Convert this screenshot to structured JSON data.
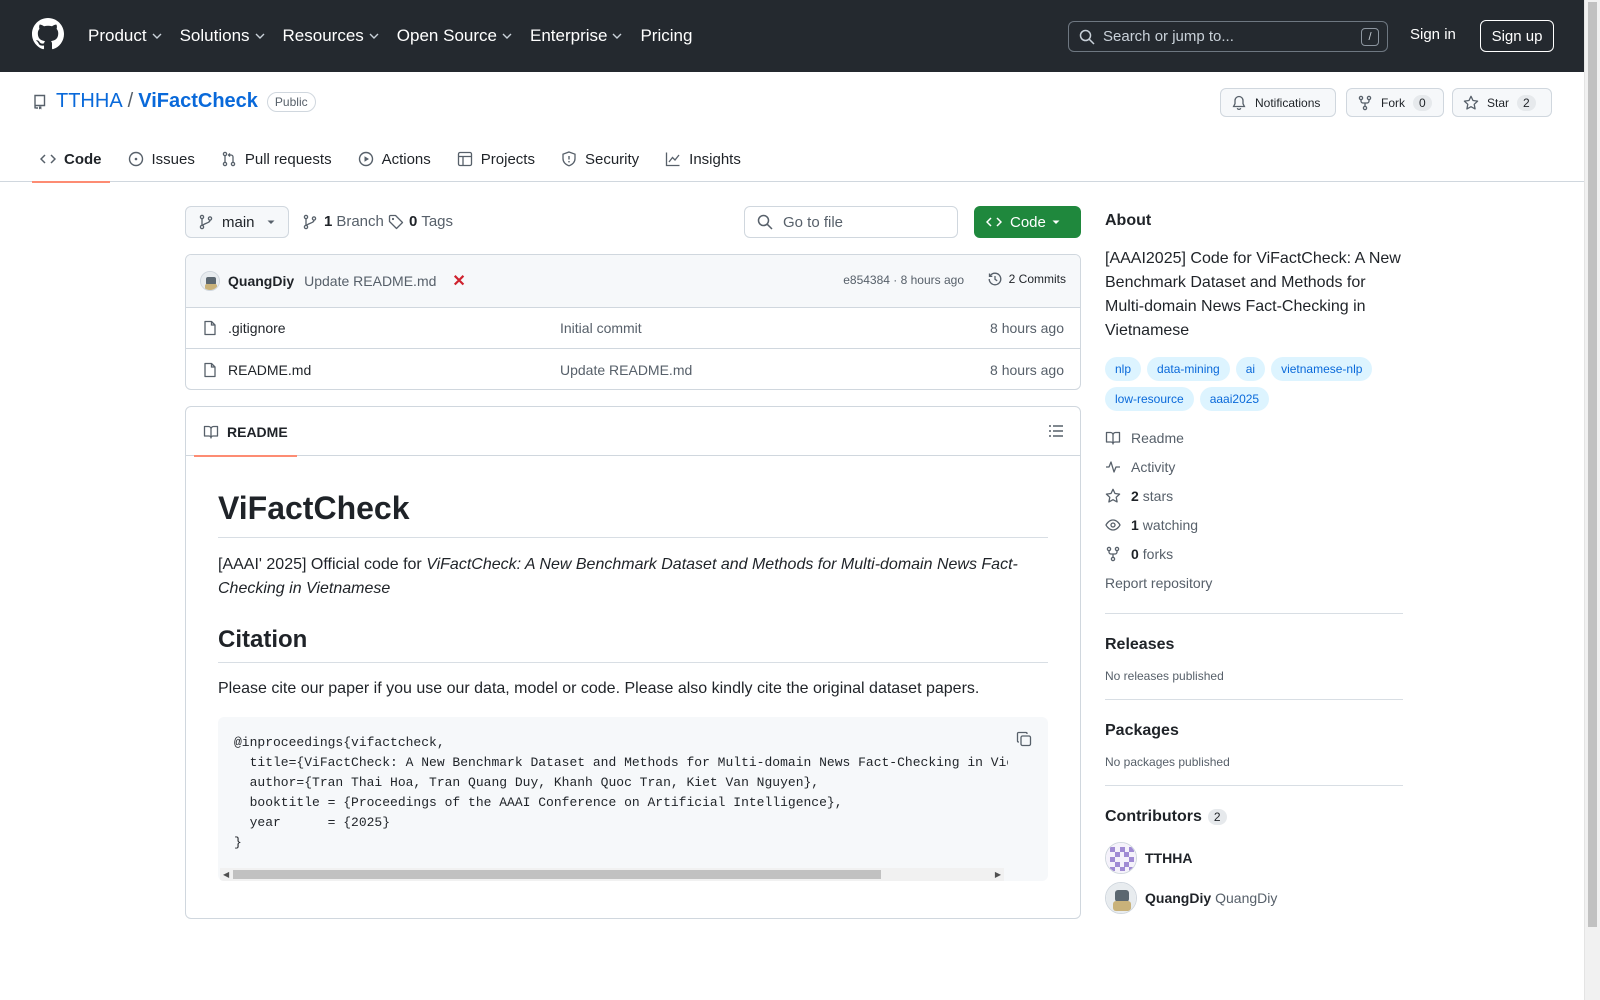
{
  "header": {
    "nav": [
      {
        "label": "Product",
        "dropdown": true
      },
      {
        "label": "Solutions",
        "dropdown": true
      },
      {
        "label": "Resources",
        "dropdown": true
      },
      {
        "label": "Open Source",
        "dropdown": true
      },
      {
        "label": "Enterprise",
        "dropdown": true
      },
      {
        "label": "Pricing",
        "dropdown": false
      }
    ],
    "search_placeholder": "Search or jump to...",
    "search_key": "/",
    "signin": "Sign in",
    "signup": "Sign up"
  },
  "repo": {
    "owner": "TTHHA",
    "separator": "/",
    "name": "ViFactCheck",
    "visibility": "Public",
    "notifications_label": "Notifications",
    "fork_label": "Fork",
    "fork_count": "0",
    "star_label": "Star",
    "star_count": "2",
    "tabs": [
      "Code",
      "Issues",
      "Pull requests",
      "Actions",
      "Projects",
      "Security",
      "Insights"
    ]
  },
  "toolbar": {
    "branch": "main",
    "branch_count": "1",
    "branch_label": "Branch",
    "tag_count": "0",
    "tag_label": "Tags",
    "goto_placeholder": "Go to file",
    "code_label": "Code"
  },
  "latest_commit": {
    "author": "QuangDiy",
    "message": "Update README.md",
    "status": "✕",
    "meta": "e854384 · 8 hours ago",
    "commits_label": "2 Commits"
  },
  "files": [
    {
      "name": ".gitignore",
      "message": "Initial commit",
      "time": "8 hours ago"
    },
    {
      "name": "README.md",
      "message": "Update README.md",
      "time": "8 hours ago"
    }
  ],
  "readme": {
    "tab_label": "README",
    "h1": "ViFactCheck",
    "intro_prefix": "[AAAI' 2025] Official code for ",
    "intro_italic": "ViFactCheck: A New Benchmark Dataset and Methods for Multi-domain News Fact-Checking in Vietnamese",
    "h2": "Citation",
    "cite_text": "Please cite our paper if you use our data, model or code. Please also kindly cite the original dataset papers.",
    "code": "@inproceedings{vifactcheck,\n  title={ViFactCheck: A New Benchmark Dataset and Methods for Multi-domain News Fact-Checking in Vietnamese},\n  author={Tran Thai Hoa, Tran Quang Duy, Khanh Quoc Tran, Kiet Van Nguyen},\n  booktitle = {Proceedings of the AAAI Conference on Artificial Intelligence},\n  year      = {2025}\n}"
  },
  "about": {
    "title": "About",
    "description": "[AAAI2025] Code for ViFactCheck: A New Benchmark Dataset and Methods for Multi-domain News Fact-Checking in Vietnamese",
    "topics": [
      "nlp",
      "data-mining",
      "ai",
      "vietnamese-nlp",
      "low-resource",
      "aaai2025"
    ],
    "readme_link": "Readme",
    "activity_link": "Activity",
    "stars_count": "2",
    "stars_label": "stars",
    "watching_count": "1",
    "watching_label": "watching",
    "forks_count": "0",
    "forks_label": "forks",
    "report": "Report repository"
  },
  "releases": {
    "title": "Releases",
    "empty": "No releases published"
  },
  "packages": {
    "title": "Packages",
    "empty": "No packages published"
  },
  "contributors": {
    "title": "Contributors",
    "count": "2",
    "list": [
      {
        "login": "TTHHA",
        "alias": ""
      },
      {
        "login": "QuangDiy",
        "alias": "QuangDiy"
      }
    ]
  },
  "colors": {
    "header_bg": "#24292f",
    "link": "#0969da",
    "primary_button": "#1f883d",
    "active_tab_underline": "#fd8c73",
    "topic_bg": "#ddf4ff",
    "error": "#cf222e"
  }
}
